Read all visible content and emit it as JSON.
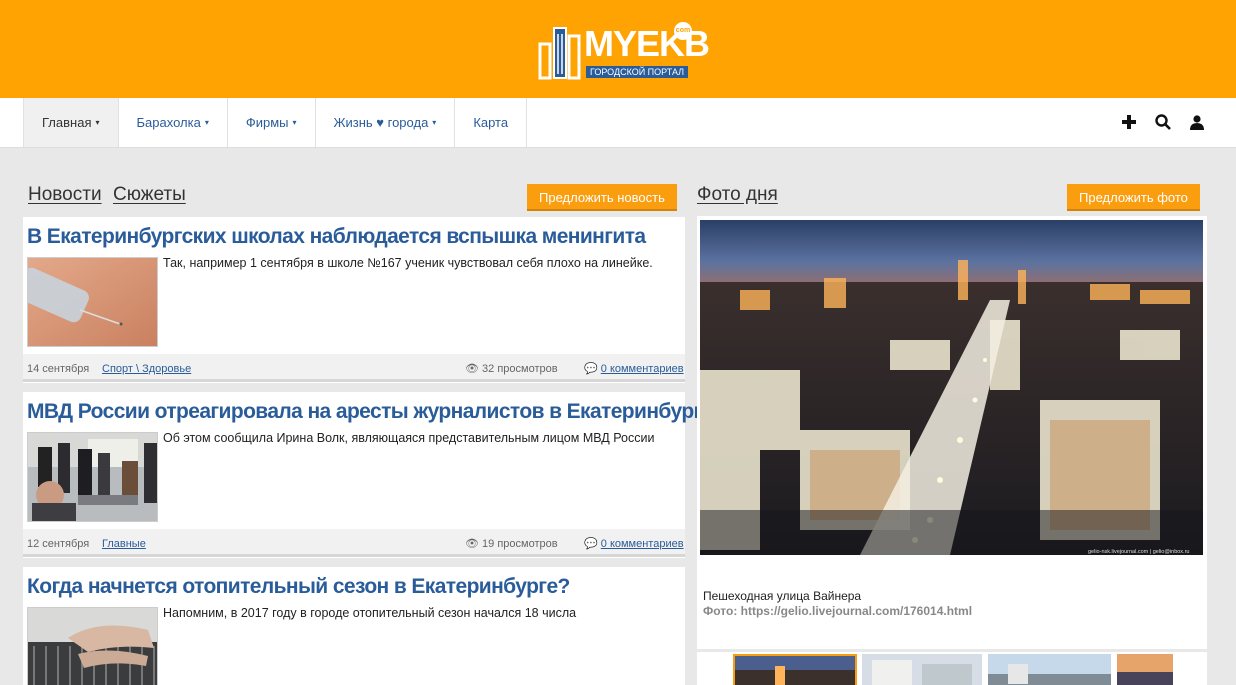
{
  "header": {
    "brand_my": "MY",
    "brand_ekb": "EKB",
    "brand_com": "com",
    "tagline": "ГОРОДСКОЙ ПОРТАЛ"
  },
  "nav": {
    "items": [
      {
        "label": "Главная",
        "caret": "▾"
      },
      {
        "label": "Барахолка",
        "caret": "▾"
      },
      {
        "label": "Фирмы",
        "caret": "▾"
      },
      {
        "label": "Жизнь ♥ города",
        "caret": "▾"
      },
      {
        "label": "Карта",
        "caret": ""
      }
    ],
    "icons": [
      "plus-icon",
      "search-icon",
      "user-icon"
    ]
  },
  "news": {
    "tab_news": "Новости",
    "tab_stories": "Сюжеты",
    "suggest_button": "Предложить новость",
    "articles": [
      {
        "title": "В Екатеринбургских школах наблюдается вспышка менингита",
        "excerpt": "Так, например 1 сентября в школе №167 ученик чувствовал себя плохо на линейке.",
        "date": "14 сентября",
        "category": "Спорт \\ Здоровье",
        "views": "32 просмотров",
        "comments": "0 комментариев"
      },
      {
        "title": "МВД России отреагировала на аресты журналистов в Екатеринбурге",
        "excerpt": "Об этом сообщила Ирина Волк, являющаяся представительным лицом МВД России",
        "date": "12 сентября",
        "category": "Главные",
        "views": "19 просмотров",
        "comments": "0 комментариев"
      },
      {
        "title": "Когда начнется отопительный сезон в Екатеринбурге?",
        "excerpt": "Напомним, в 2017 году в городе отопительный сезон начался 18 числа"
      }
    ]
  },
  "photo": {
    "heading": "Фото дня",
    "suggest_button": "Предложить фото",
    "caption": "Пешеходная улица Вайнера",
    "credit": "Фото: https://gelio.livejournal.com/176014.html",
    "watermark": "gelio-nsk.livejournal.com | gelio@inbox.ru"
  },
  "colors": {
    "header_bg": "#fea301",
    "link_blue": "#2a5c9a",
    "button_orange": "#fa9e10"
  }
}
